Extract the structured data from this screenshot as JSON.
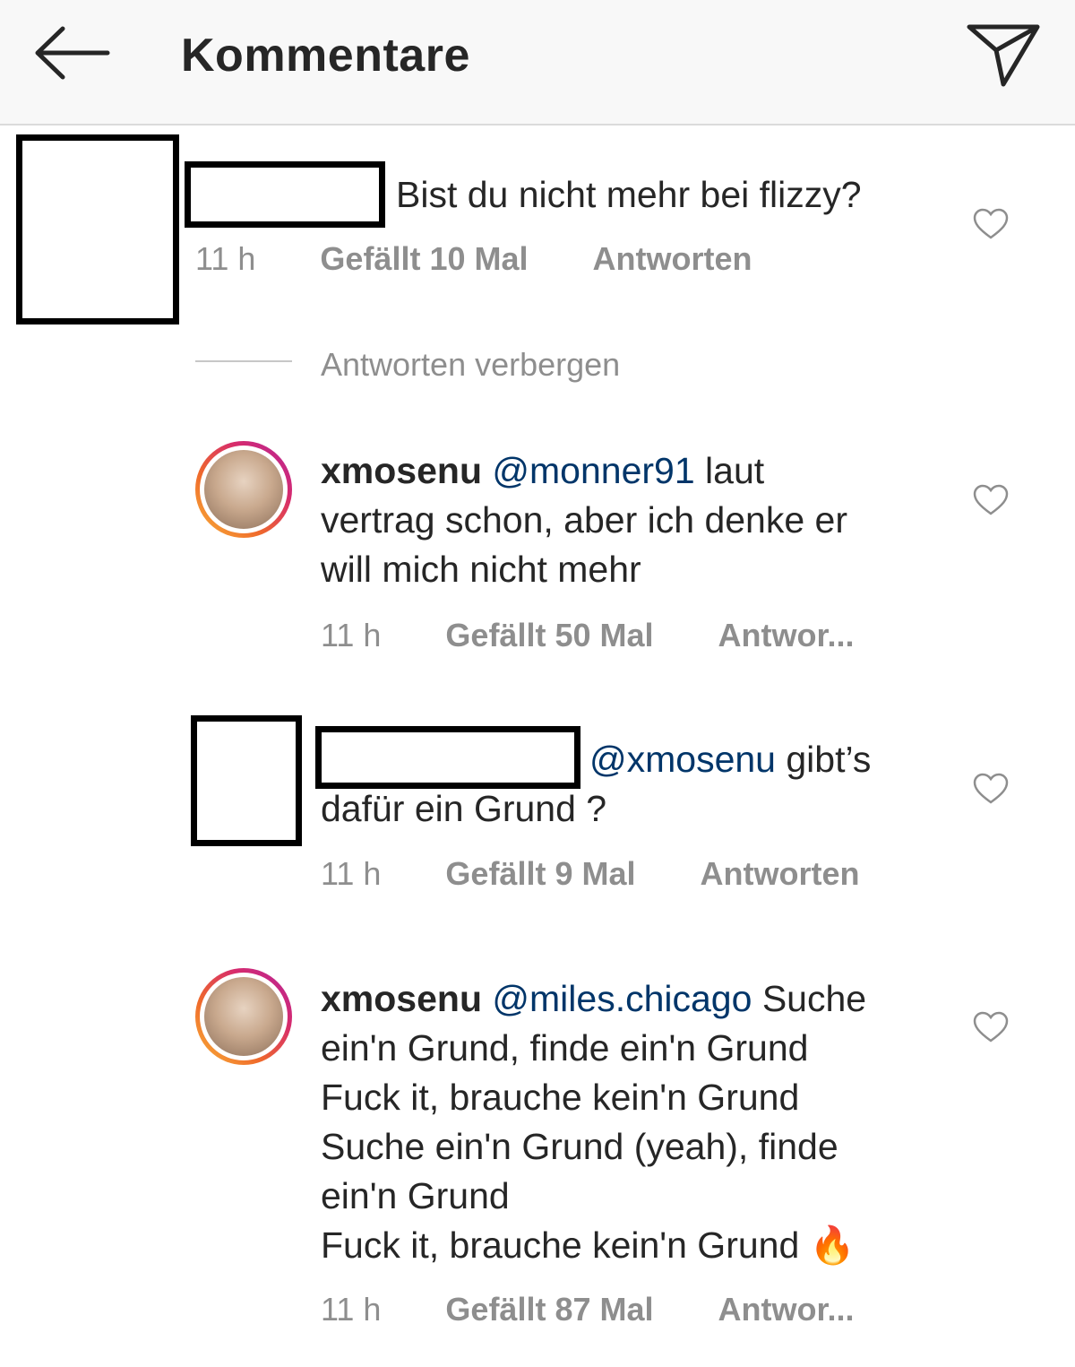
{
  "header": {
    "title": "Kommentare",
    "back_icon": "arrow-left-icon",
    "send_icon": "paper-plane-icon"
  },
  "comments": [
    {
      "text": "Bist du nicht mehr bei flizzy?",
      "time": "11 h",
      "likes": "Gefällt 10 Mal",
      "reply": "Antworten"
    }
  ],
  "hide_replies": "Antworten verbergen",
  "replies": [
    {
      "username": "xmosenu",
      "mention": "@monner91",
      "text_lines": [
        " laut",
        "vertrag schon, aber ich denke er",
        "will mich nicht mehr"
      ],
      "time": "11 h",
      "likes": "Gefällt 50 Mal",
      "reply": "Antwor..."
    },
    {
      "mention": "@xmosenu",
      "text_lines": [
        " gibt’s",
        "dafür ein Grund ?"
      ],
      "time": "11 h",
      "likes": "Gefällt 9 Mal",
      "reply": "Antworten"
    },
    {
      "username": "xmosenu",
      "mention": "@miles.chicago",
      "text_lines": [
        " Suche",
        "ein'n Grund, finde ein'n Grund",
        "Fuck it, brauche kein'n Grund",
        "Suche ein'n Grund (yeah), finde",
        "ein'n Grund",
        "Fuck it, brauche kein'n Grund "
      ],
      "emoji": "🔥",
      "time": "11 h",
      "likes": "Gefällt 87 Mal",
      "reply": "Antwor..."
    }
  ],
  "colors": {
    "mention": "#003569",
    "meta": "#8e8e8e",
    "header_bg": "#f8f8f8"
  }
}
